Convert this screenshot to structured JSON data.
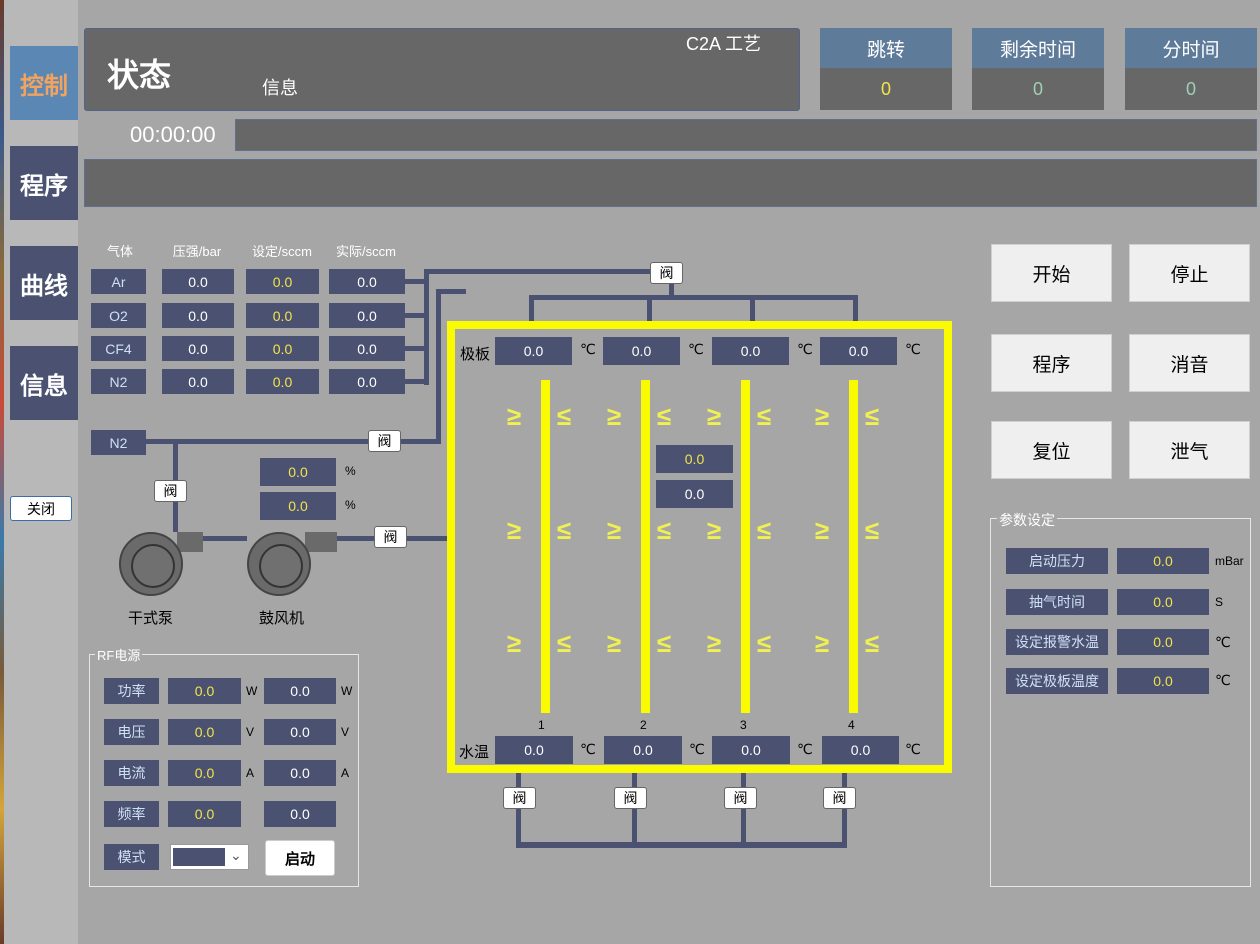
{
  "nav": {
    "items": [
      "控制",
      "程序",
      "曲线",
      "信息"
    ],
    "close_label": "关闭"
  },
  "status": {
    "title": "状态",
    "info_label": "信息",
    "process_name": "C2A 工艺",
    "elapsed": "00:00:00"
  },
  "counters": [
    {
      "label": "跳转",
      "value": "0"
    },
    {
      "label": "剩余时间",
      "value": "0"
    },
    {
      "label": "分时间",
      "value": "0"
    }
  ],
  "gas": {
    "headers": [
      "气体",
      "压强/bar",
      "设定/sccm",
      "实际/sccm"
    ],
    "rows": [
      {
        "name": "Ar",
        "pressure": "0.0",
        "set": "0.0",
        "actual": "0.0"
      },
      {
        "name": "O2",
        "pressure": "0.0",
        "set": "0.0",
        "actual": "0.0"
      },
      {
        "name": "CF4",
        "pressure": "0.0",
        "set": "0.0",
        "actual": "0.0"
      },
      {
        "name": "N2",
        "pressure": "0.0",
        "set": "0.0",
        "actual": "0.0"
      }
    ],
    "n2_line": "N2"
  },
  "valve_label": "阀",
  "pump": {
    "pct1": "0.0",
    "pct2": "0.0",
    "pct_unit": "%",
    "dry_pump_label": "干式泵",
    "blower_label": "鼓风机"
  },
  "chamber": {
    "plate_label": "极板",
    "plate_temps": [
      "0.0",
      "0.0",
      "0.0",
      "0.0"
    ],
    "water_label": "水温",
    "water_temps": [
      "0.0",
      "0.0",
      "0.0",
      "0.0"
    ],
    "temp_unit": "℃",
    "electrode_numbers": [
      "1",
      "2",
      "3",
      "4"
    ],
    "center_vals": [
      "0.0",
      "0.0"
    ]
  },
  "rf": {
    "title": "RF电源",
    "rows": [
      {
        "label": "功率",
        "v1": "0.0",
        "u1": "W",
        "v2": "0.0",
        "u2": "W"
      },
      {
        "label": "电压",
        "v1": "0.0",
        "u1": "V",
        "v2": "0.0",
        "u2": "V"
      },
      {
        "label": "电流",
        "v1": "0.0",
        "u1": "A",
        "v2": "0.0",
        "u2": "A"
      },
      {
        "label": "频率",
        "v1": "0.0",
        "u1": "",
        "v2": "0.0",
        "u2": ""
      }
    ],
    "mode_label": "模式",
    "mode_value": "",
    "start_label": "启动"
  },
  "actions": {
    "start": "开始",
    "stop": "停止",
    "program": "程序",
    "mute": "消音",
    "reset": "复位",
    "vent": "泄气"
  },
  "params": {
    "title": "参数设定",
    "rows": [
      {
        "label": "启动压力",
        "value": "0.0",
        "unit": "mBar"
      },
      {
        "label": "抽气时间",
        "value": "0.0",
        "unit": "S"
      },
      {
        "label": "设定报警水温",
        "value": "0.0",
        "unit": "℃"
      },
      {
        "label": "设定极板温度",
        "value": "0.0",
        "unit": "℃"
      }
    ]
  }
}
